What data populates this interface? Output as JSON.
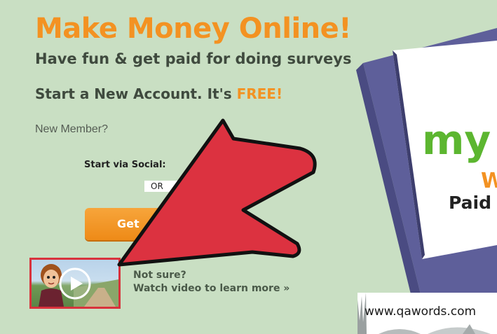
{
  "hero": {
    "headline": "Make Money Online!",
    "subhead": "Have fun & get paid for doing surveys"
  },
  "signup": {
    "line_prefix": "Start a New Account. It's ",
    "line_free": "FREE!",
    "new_member": "New Member?",
    "social_label": "Start via Social:",
    "or_label": "OR",
    "get_started_partial": "Get"
  },
  "video": {
    "not_sure": "Not sure?",
    "watch_link": "Watch video to learn more »"
  },
  "monitor": {
    "logo_partial": "my",
    "word_partial": "W",
    "tagline_partial": "Paid"
  },
  "watermark": {
    "text": "www.qawords.com"
  },
  "colors": {
    "background": "#c9dfc3",
    "accent_orange": "#f39222",
    "arrow_red": "#dc3240",
    "monitor_purple": "#5e5f9a",
    "logo_green": "#5cb630"
  }
}
